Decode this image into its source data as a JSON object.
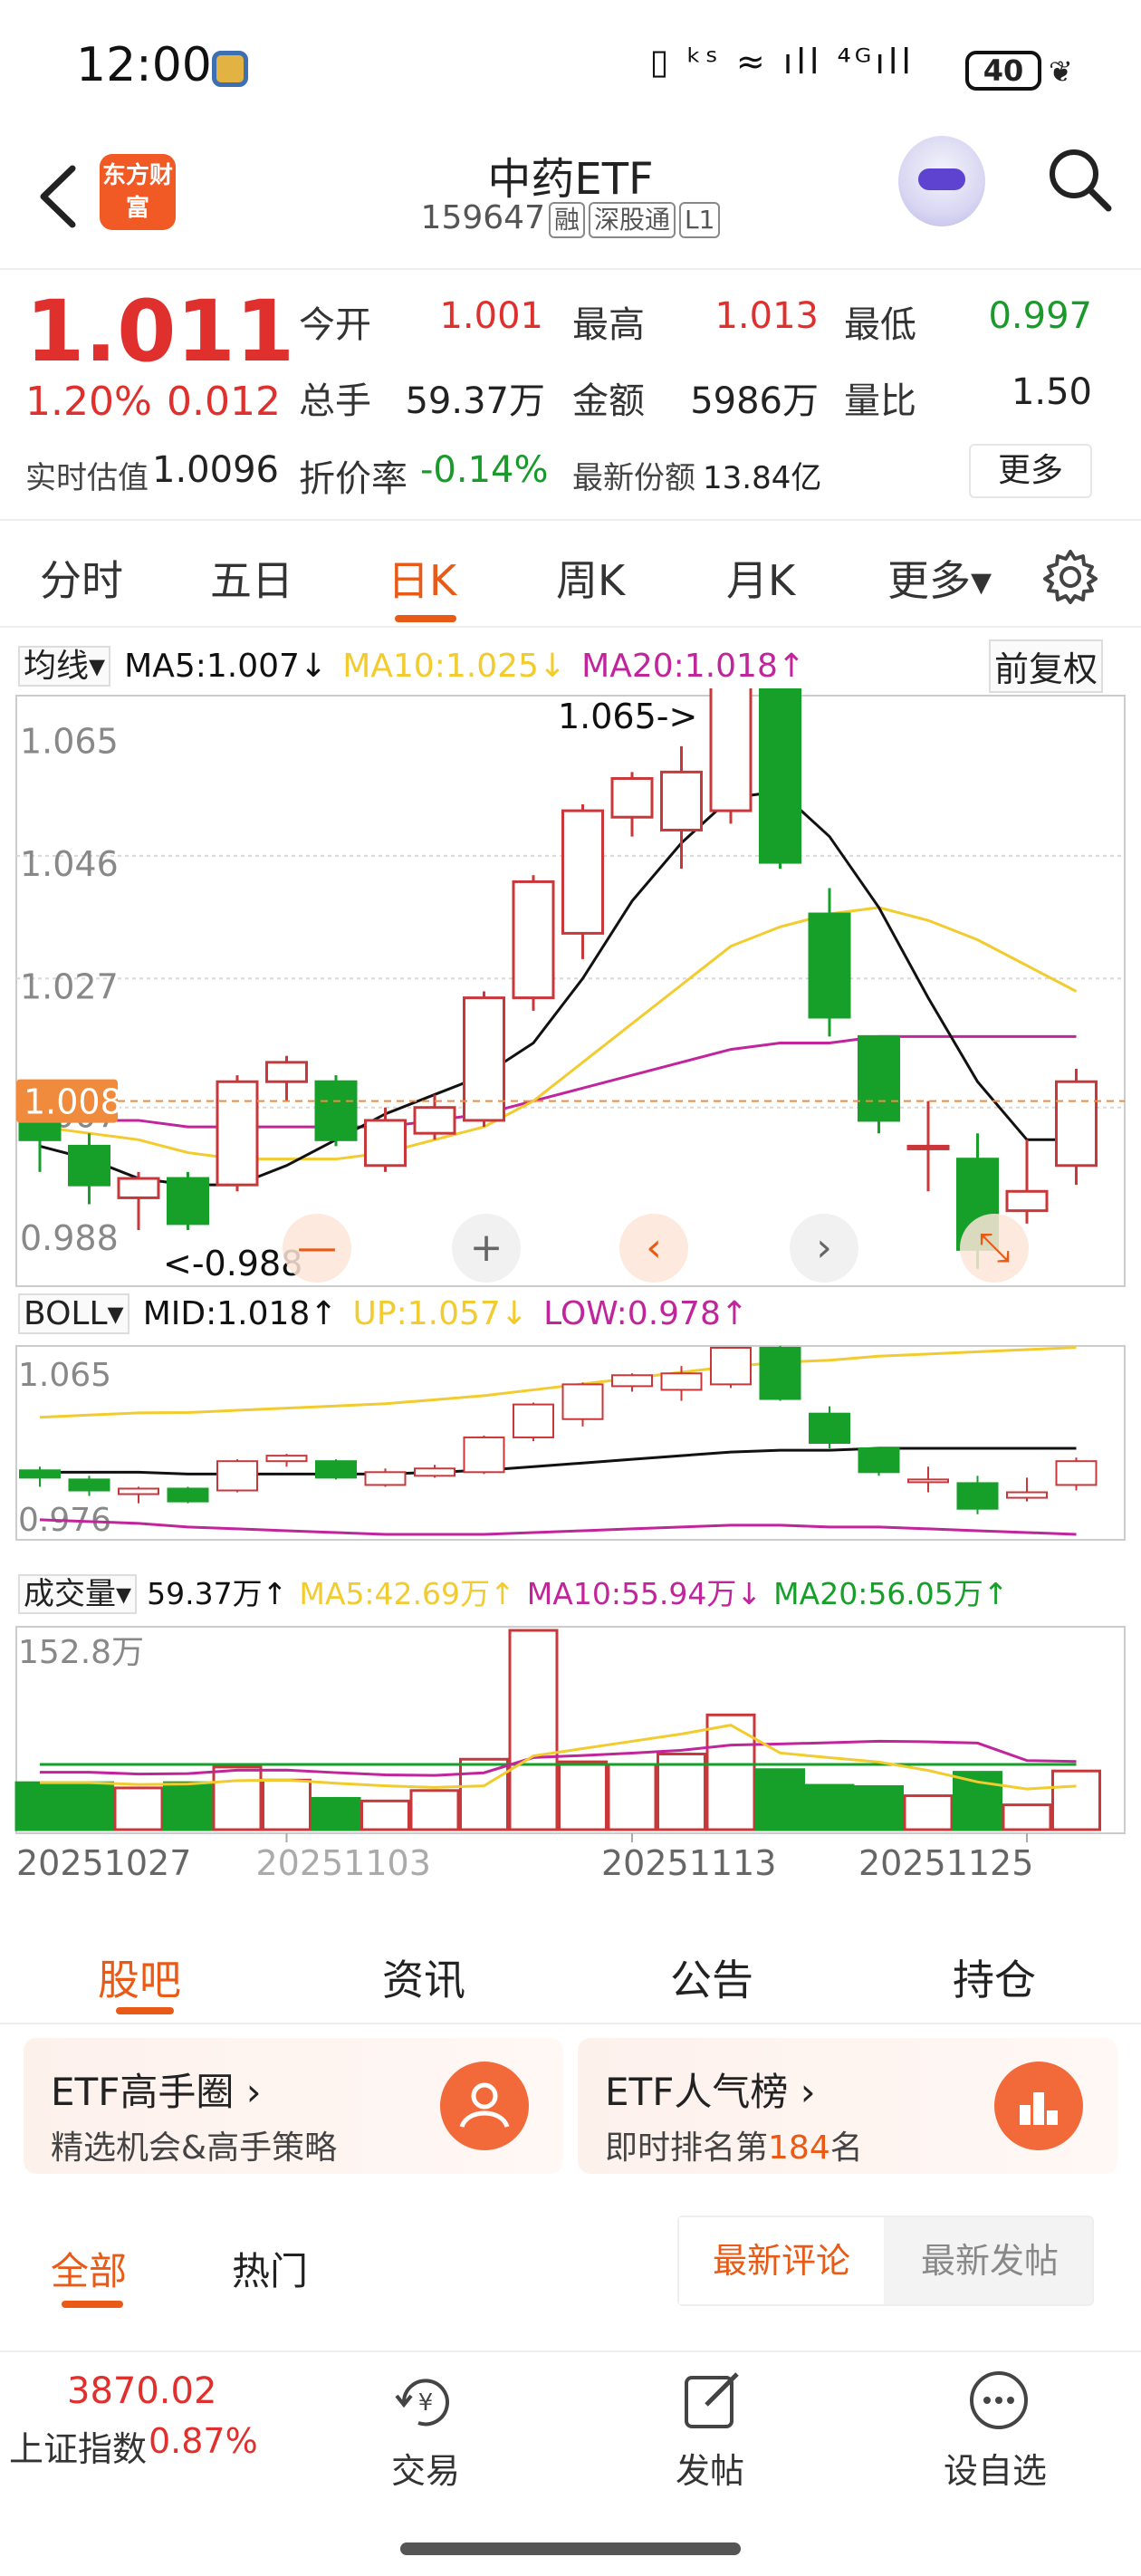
{
  "status": {
    "time": "12:00",
    "icons": "▯ ᵏˢ ≈ ıll ⁴ᴳıll",
    "battery": "40"
  },
  "header": {
    "title": "中药ETF",
    "code": "159647",
    "tags": [
      "融",
      "深股通",
      "L1"
    ],
    "logo_text": "东方财富"
  },
  "quote": {
    "price": "1.011",
    "pct": "1.20%",
    "chg": "0.012",
    "open_label": "今开",
    "open": "1.001",
    "high_label": "最高",
    "high": "1.013",
    "low_label": "最低",
    "low": "0.997",
    "vol_label": "总手",
    "vol": "59.37万",
    "amt_label": "金额",
    "amt": "5986万",
    "ratio_label": "量比",
    "ratio": "1.50",
    "iopv_label": "实时估值",
    "iopv": "1.0096",
    "disc_label": "折价率",
    "disc": "-0.14%",
    "share_label": "最新份额",
    "share": "13.84亿",
    "more": "更多"
  },
  "tabs": {
    "items": [
      "分时",
      "五日",
      "日K",
      "周K",
      "月K",
      "更多▾"
    ],
    "active": 2
  },
  "ma": {
    "selector": "均线▾",
    "ma5": "MA5:1.007↓",
    "ma10": "MA10:1.025↓",
    "ma20": "MA20:1.018↑"
  },
  "fuquan": "前复权",
  "boll": {
    "selector": "BOLL▾",
    "mid": "MID:1.018↑",
    "up": "UP:1.057↓",
    "low": "LOW:0.978↑"
  },
  "volrow": {
    "selector": "成交量▾",
    "vol": "59.37万↑",
    "ma5": "MA5:42.69万↑",
    "ma10": "MA10:55.94万↓",
    "ma20": "MA20:56.05万↑"
  },
  "colors": {
    "up": "#c8373a",
    "down": "#16a02a",
    "ma5": "#111111",
    "ma10": "#f2cb2e",
    "ma20": "#c0259c",
    "accent": "#e85a16"
  },
  "chart_data": {
    "type": "candlestick",
    "main": {
      "y_ticks": [
        "1.065",
        "1.046",
        "1.027",
        "1.007",
        "0.988"
      ],
      "current": "1.008",
      "max_label": "1.065->",
      "min_label": "<-0.988",
      "candles": [
        {
          "o": 1.006,
          "c": 1.002,
          "h": 1.008,
          "l": 0.997
        },
        {
          "o": 1.001,
          "c": 0.995,
          "h": 1.003,
          "l": 0.992
        },
        {
          "o": 0.993,
          "c": 0.996,
          "h": 0.997,
          "l": 0.988
        },
        {
          "o": 0.996,
          "c": 0.989,
          "h": 0.997,
          "l": 0.988
        },
        {
          "o": 0.995,
          "c": 1.011,
          "h": 1.012,
          "l": 0.994
        },
        {
          "o": 1.011,
          "c": 1.014,
          "h": 1.015,
          "l": 1.008
        },
        {
          "o": 1.011,
          "c": 1.002,
          "h": 1.012,
          "l": 1.001
        },
        {
          "o": 0.998,
          "c": 1.005,
          "h": 1.007,
          "l": 0.997
        },
        {
          "o": 1.003,
          "c": 1.007,
          "h": 1.009,
          "l": 1.002
        },
        {
          "o": 1.005,
          "c": 1.024,
          "h": 1.025,
          "l": 1.004
        },
        {
          "o": 1.024,
          "c": 1.042,
          "h": 1.043,
          "l": 1.022
        },
        {
          "o": 1.034,
          "c": 1.053,
          "h": 1.054,
          "l": 1.03
        },
        {
          "o": 1.052,
          "c": 1.058,
          "h": 1.059,
          "l": 1.049
        },
        {
          "o": 1.05,
          "c": 1.059,
          "h": 1.063,
          "l": 1.044
        },
        {
          "o": 1.053,
          "c": 1.073,
          "h": 1.065,
          "l": 1.051
        },
        {
          "o": 1.073,
          "c": 1.045,
          "h": 1.074,
          "l": 1.044
        },
        {
          "o": 1.037,
          "c": 1.021,
          "h": 1.041,
          "l": 1.018
        },
        {
          "o": 1.018,
          "c": 1.005,
          "h": 1.018,
          "l": 1.003
        },
        {
          "o": 1.001,
          "c": 1.001,
          "h": 1.008,
          "l": 0.994
        },
        {
          "o": 0.999,
          "c": 0.985,
          "h": 1.003,
          "l": 0.982
        },
        {
          "o": 0.991,
          "c": 0.994,
          "h": 1.002,
          "l": 0.989
        },
        {
          "o": 0.998,
          "c": 1.011,
          "h": 1.013,
          "l": 0.995
        }
      ],
      "ma5": [
        1.001,
        0.999,
        0.996,
        0.995,
        0.995,
        0.998,
        1.002,
        1.006,
        1.009,
        1.012,
        1.017,
        1.027,
        1.039,
        1.048,
        1.055,
        1.056,
        1.049,
        1.038,
        1.024,
        1.011,
        1.002,
        1.002
      ],
      "ma10": [
        1.004,
        1.003,
        1.002,
        1.0,
        0.999,
        0.999,
        0.999,
        1.0,
        1.002,
        1.004,
        1.008,
        1.014,
        1.02,
        1.026,
        1.032,
        1.035,
        1.037,
        1.038,
        1.036,
        1.033,
        1.029,
        1.025
      ],
      "ma20": [
        1.005,
        1.005,
        1.005,
        1.004,
        1.004,
        1.004,
        1.004,
        1.004,
        1.005,
        1.006,
        1.008,
        1.01,
        1.012,
        1.014,
        1.016,
        1.017,
        1.017,
        1.018,
        1.018,
        1.018,
        1.018,
        1.018
      ]
    },
    "boll_panel": {
      "y_ticks": [
        "1.065",
        "0.976"
      ]
    },
    "volume": {
      "y_tick": "152.8万",
      "values": [
        36,
        36,
        32,
        36,
        48,
        38,
        24,
        22,
        30,
        54,
        152.8,
        52,
        50,
        58,
        88,
        46,
        34,
        33,
        26,
        44,
        19,
        45
      ],
      "x_labels": [
        "20251027",
        "20251103",
        "20251113",
        "20251125"
      ]
    }
  },
  "bottom": {
    "tabs": [
      "股吧",
      "资讯",
      "公告",
      "持仓"
    ],
    "card1": {
      "title": "ETF高手圈 ›",
      "sub": "精选机会&高手策略"
    },
    "card2": {
      "title": "ETF人气榜 ›",
      "sub_pre": "即时排名第",
      "rank": "184",
      "sub_post": "名"
    },
    "filters": [
      "全部",
      "热门"
    ],
    "sort": [
      "最新评论",
      "最新发帖"
    ],
    "index_value": "3870.02",
    "index_name": "上证指数",
    "index_pct": "0.87%",
    "nav": [
      "交易",
      "发帖",
      "设自选"
    ]
  }
}
